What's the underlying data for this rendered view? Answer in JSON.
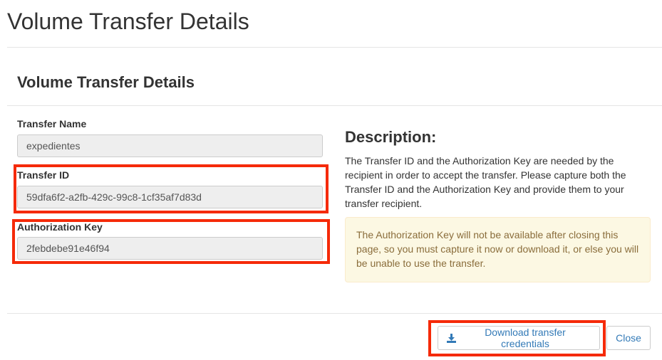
{
  "page": {
    "title": "Volume Transfer Details"
  },
  "modal": {
    "title": "Volume Transfer Details"
  },
  "form": {
    "transfer_name": {
      "label": "Transfer Name",
      "value": "expedientes"
    },
    "transfer_id": {
      "label": "Transfer ID",
      "value": "59dfa6f2-a2fb-429c-99c8-1cf35af7d83d"
    },
    "authorization_key": {
      "label": "Authorization Key",
      "value": "2febdebe91e46f94"
    }
  },
  "description": {
    "heading": "Description:",
    "text": "The Transfer ID and the Authorization Key are needed by the recipient in order to accept the transfer. Please capture both the Transfer ID and the Authorization Key and provide them to your transfer recipient.",
    "warning": "The Authorization Key will not be available after closing this page, so you must capture it now or download it, or else you will be unable to use the transfer."
  },
  "footer": {
    "download_label": "Download transfer credentials",
    "close_label": "Close"
  },
  "colors": {
    "highlight": "#f52a09",
    "link": "#337ab7",
    "warning_bg": "#fcf8e3",
    "warning_text": "#8a6d3b"
  },
  "icons": {
    "download": "download-icon"
  }
}
